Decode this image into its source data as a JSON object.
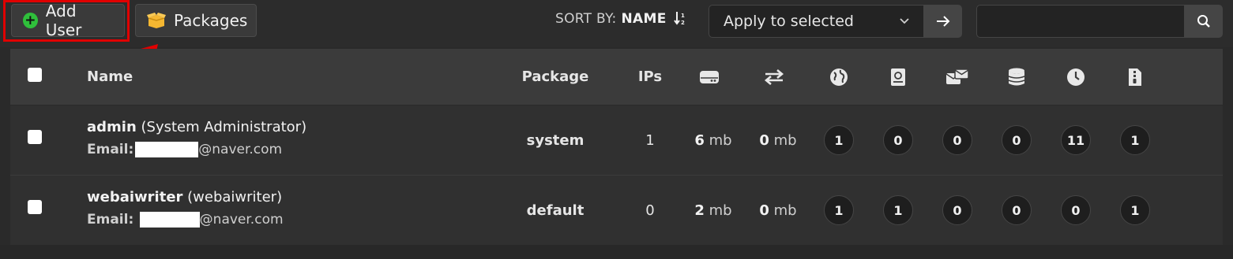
{
  "toolbar": {
    "add_user_label": "Add User",
    "packages_label": "Packages",
    "sort_by_label": "SORT BY:",
    "sort_field": "NAME",
    "apply_select_value": "Apply to selected",
    "search_value": ""
  },
  "table": {
    "headers": {
      "name": "Name",
      "package": "Package",
      "ips": "IPs"
    },
    "header_icons": [
      "disk-icon",
      "bandwidth-icon",
      "web-domains-icon",
      "dns-icon",
      "mail-icon",
      "database-icon",
      "cron-icon",
      "backup-icon"
    ],
    "rows": [
      {
        "username": "admin",
        "fullname": "(System Administrator)",
        "email_label": "Email:",
        "email_domain": "@naver.com",
        "package": "system",
        "ips": "1",
        "disk_value": "6",
        "disk_unit": "mb",
        "bandwidth_value": "0",
        "bandwidth_unit": "mb",
        "web": "1",
        "dns": "0",
        "mail": "0",
        "db": "0",
        "cron": "11",
        "backups": "1"
      },
      {
        "username": "webaiwriter",
        "fullname": "(webaiwriter)",
        "email_label": "Email:",
        "email_domain": "@naver.com",
        "package": "default",
        "ips": "0",
        "disk_value": "2",
        "disk_unit": "mb",
        "bandwidth_value": "0",
        "bandwidth_unit": "mb",
        "web": "1",
        "dns": "1",
        "mail": "0",
        "db": "0",
        "cron": "0",
        "backups": "1"
      }
    ]
  },
  "colors": {
    "highlight": "#e00000",
    "add_icon": "#2fbf3b",
    "packages_icon": "#f5b731"
  }
}
